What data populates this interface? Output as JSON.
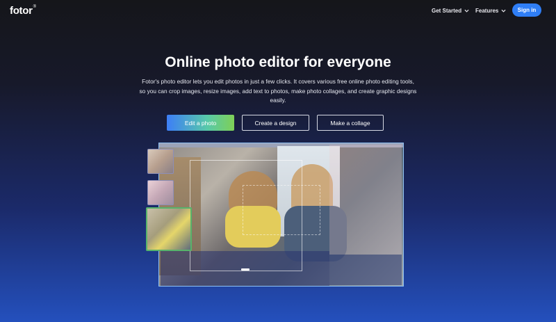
{
  "nav": {
    "logo": "fotor",
    "logo_mark": "®",
    "menu": [
      {
        "label": "Get Started"
      },
      {
        "label": "Features"
      }
    ],
    "signin": "Sign in"
  },
  "hero": {
    "title": "Online photo editor for everyone",
    "description": "Fotor's photo editor lets you edit photos in just a few clicks. It covers various free online photo editing tools, so you can crop images, resize images, add text to photos, make photo collages, and create graphic designs easily.",
    "buttons": {
      "edit": "Edit a photo",
      "design": "Create a design",
      "collage": "Make a collage"
    }
  },
  "colors": {
    "accent": "#2f7ef5",
    "gradient_start": "#3d7ef7",
    "gradient_end": "#7ed057",
    "selection_border": "#57b36b"
  },
  "icons": [
    "chevron-down-icon"
  ]
}
